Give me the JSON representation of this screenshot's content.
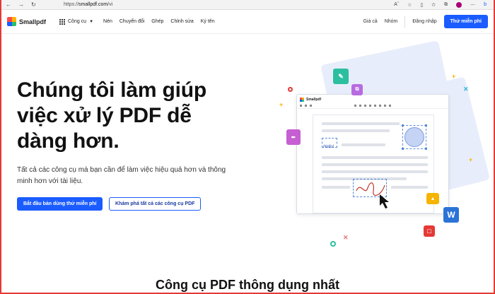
{
  "browser": {
    "url_prefix": "https://",
    "url_domain": "smallpdf.com",
    "url_path": "/vi"
  },
  "brand": {
    "name": "Smallpdf"
  },
  "nav": {
    "tools_label": "Công cụ",
    "items": [
      "Nén",
      "Chuyển đổi",
      "Ghép",
      "Chỉnh sửa",
      "Ký tên"
    ],
    "pricing": "Giá cả",
    "teams": "Nhóm",
    "login": "Đăng nhập",
    "trial": "Thử miễn phí"
  },
  "hero": {
    "title": "Chúng tôi làm giúp việc xử lý PDF dễ dàng hơn.",
    "subtitle": "Tất cả các công cụ mà bạn cần để làm việc hiệu quả hơn và thông minh hơn với tài liệu.",
    "primary_cta": "Bắt đầu bản dùng thử miễn phí",
    "secondary_cta": "Khám phá tất cả các công cụ PDF"
  },
  "illustration": {
    "app_name": "Smallpdf",
    "sign_text": "Hello!",
    "word_badge": "W"
  },
  "section": {
    "title": "Công cụ PDF thông dụng nhất"
  },
  "colors": {
    "accent": "#1a5cff",
    "frame": "#e53935"
  }
}
